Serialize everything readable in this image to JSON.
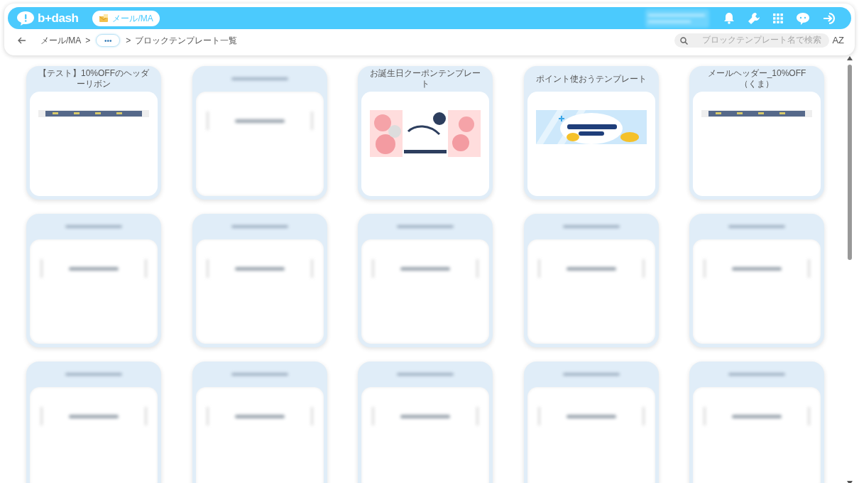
{
  "header": {
    "logo": "b+dash",
    "module_tab": "メール/MA"
  },
  "breadcrumb": {
    "items": [
      "メール/MA",
      ">",
      "•••",
      ">",
      "ブロックテンプレート一覧"
    ]
  },
  "search": {
    "placeholder": "ブロックテンプレート名で検索"
  },
  "sort_button": "AZ",
  "cards": [
    {
      "kind": "picture",
      "title": "【テスト】10%OFFのヘッダーリボン"
    },
    {
      "kind": "blurred"
    },
    {
      "kind": "picture",
      "title": "お誕生日クーポンテンプレート"
    },
    {
      "kind": "picture",
      "title": "ポイント使おうテンプレート"
    },
    {
      "kind": "picture",
      "title": "メールヘッダー_10%OFF（くま）"
    },
    {
      "kind": "blurred"
    },
    {
      "kind": "blurred"
    },
    {
      "kind": "blurred"
    },
    {
      "kind": "blurred"
    },
    {
      "kind": "blurred"
    },
    {
      "kind": "blurred"
    },
    {
      "kind": "blurred"
    },
    {
      "kind": "blurred"
    },
    {
      "kind": "blurred"
    },
    {
      "kind": "blurred"
    }
  ]
}
